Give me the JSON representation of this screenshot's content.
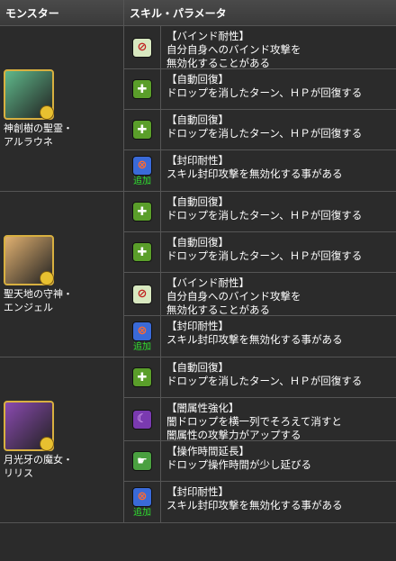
{
  "header": {
    "col_monster": "モンスター",
    "col_skill": "スキル・パラメータ"
  },
  "groups": [
    {
      "name_line1": "神創樹の聖霊・",
      "name_line2": "アルラウネ",
      "avatar_color": "#5fb88a",
      "skills": [
        {
          "icon": "bind-resist-icon",
          "added": false,
          "title": "【バインド耐性】",
          "desc1": "自分自身へのバインド攻撃を",
          "desc2": "無効化することがある"
        },
        {
          "icon": "auto-heal-icon",
          "added": false,
          "title": "【自動回復】",
          "desc1": "ドロップを消したターン、ＨＰが回復する",
          "desc2": ""
        },
        {
          "icon": "auto-heal-icon",
          "added": false,
          "title": "【自動回復】",
          "desc1": "ドロップを消したターン、ＨＰが回復する",
          "desc2": ""
        },
        {
          "icon": "seal-resist-icon",
          "added": true,
          "title": "【封印耐性】",
          "desc1": "スキル封印攻撃を無効化する事がある",
          "desc2": ""
        }
      ]
    },
    {
      "name_line1": "聖天地の守神・",
      "name_line2": "エンジェル",
      "avatar_color": "#e0b070",
      "skills": [
        {
          "icon": "auto-heal-icon",
          "added": false,
          "title": "【自動回復】",
          "desc1": "ドロップを消したターン、ＨＰが回復する",
          "desc2": ""
        },
        {
          "icon": "auto-heal-icon",
          "added": false,
          "title": "【自動回復】",
          "desc1": "ドロップを消したターン、ＨＰが回復する",
          "desc2": ""
        },
        {
          "icon": "bind-resist-icon",
          "added": false,
          "title": "【バインド耐性】",
          "desc1": "自分自身へのバインド攻撃を",
          "desc2": "無効化することがある"
        },
        {
          "icon": "seal-resist-icon",
          "added": true,
          "title": "【封印耐性】",
          "desc1": "スキル封印攻撃を無効化する事がある",
          "desc2": ""
        }
      ]
    },
    {
      "name_line1": "月光牙の魔女・",
      "name_line2": "リリス",
      "avatar_color": "#8a4ab0",
      "skills": [
        {
          "icon": "auto-heal-icon",
          "added": false,
          "title": "【自動回復】",
          "desc1": "ドロップを消したターン、ＨＰが回復する",
          "desc2": ""
        },
        {
          "icon": "dark-enhance-icon",
          "added": false,
          "title": "【闇属性強化】",
          "desc1": "闇ドロップを横一列でそろえて消すと",
          "desc2": "闇属性の攻撃力がアップする"
        },
        {
          "icon": "time-extend-icon",
          "added": false,
          "title": "【操作時間延長】",
          "desc1": "ドロップ操作時間が少し延びる",
          "desc2": ""
        },
        {
          "icon": "seal-resist-icon",
          "added": true,
          "title": "【封印耐性】",
          "desc1": "スキル封印攻撃を無効化する事がある",
          "desc2": ""
        }
      ]
    }
  ],
  "added_label": "追加"
}
